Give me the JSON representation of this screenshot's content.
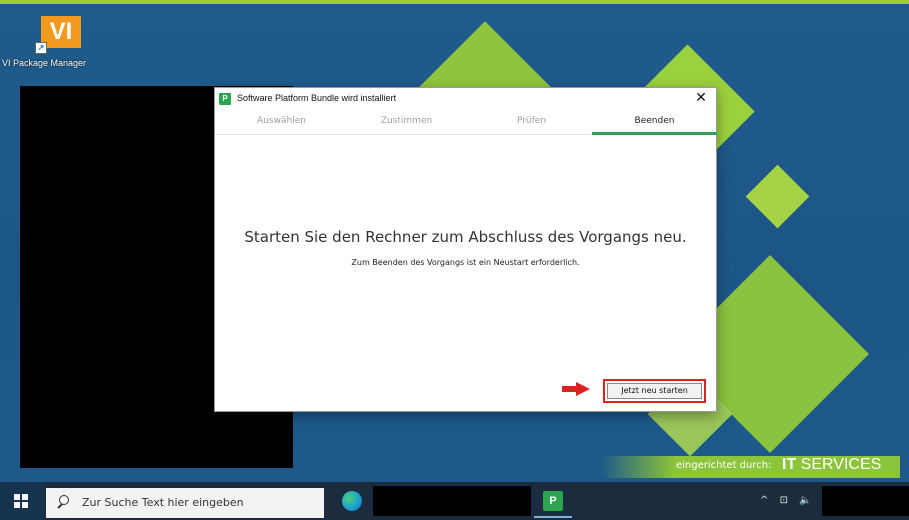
{
  "desktop": {
    "icons": [
      {
        "name": "VI Package Manager",
        "tile_text": "VI"
      }
    ],
    "branding": {
      "prefix": "eingerichtet durch:",
      "logo_bold": "IT",
      "logo_rest": "SERVICES"
    }
  },
  "dialog": {
    "app_icon_letter": "P",
    "title": "Software Platform Bundle wird installiert",
    "close_glyph": "✕",
    "tabs": [
      {
        "label": "Auswählen",
        "active": false
      },
      {
        "label": "Zustimmen",
        "active": false
      },
      {
        "label": "Prüfen",
        "active": false
      },
      {
        "label": "Beenden",
        "active": true
      }
    ],
    "message": "Starten Sie den Rechner zum Abschluss des Vorgangs neu.",
    "submessage": "Zum Beenden des Vorgangs ist ein Neustart erforderlich.",
    "restart_label": "Jetzt neu starten"
  },
  "taskbar": {
    "search_placeholder": "Zur Suche Text hier eingeben",
    "pinned_app_letter": "P",
    "tray_icons": [
      "chevron-up-icon",
      "network-icon",
      "volume-icon"
    ],
    "tray_glyphs": [
      "^",
      "⊡",
      "🔈"
    ]
  },
  "colors": {
    "accent_green": "#2e9e5a",
    "highlight_red": "#e02020",
    "desktop_blue": "#1d5a89",
    "brand_green": "#8cc43b"
  }
}
